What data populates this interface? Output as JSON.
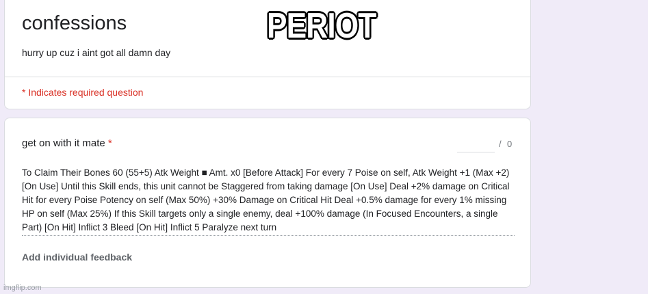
{
  "form": {
    "title": "confessions",
    "description": "hurry up cuz i aint got all damn day",
    "required_note": "* Indicates required question"
  },
  "overlay": {
    "text": "PERIOT"
  },
  "question": {
    "title": "get on with it mate",
    "required_star": "*",
    "points_separator": "/",
    "points_total": "0",
    "answer": "To Claim Their Bones 60 (55+5) Atk Weight ■ Amt. x0 [Before Attack] For every 7 Poise on self, Atk Weight +1 (Max +2) [On Use] Until this Skill ends, this unit cannot be Staggered from taking damage [On Use] Deal +2% damage on Critical Hit for every Poise Potency on self (Max 50%) +30% Damage on Critical Hit Deal +0.5% damage for every 1% missing HP on self (Max 25%) If this Skill targets only a single enemy, deal +100% damage (In Focused Encounters, a single Part) [On Hit] Inflict 3 Bleed [On Hit] Inflict 5 Paralyze next turn",
    "feedback_label": "Add individual feedback"
  },
  "watermark": "imgflip.com",
  "colors": {
    "background": "#f0ebf8",
    "required": "#d93025",
    "card": "#ffffff",
    "border": "#dadce0"
  }
}
